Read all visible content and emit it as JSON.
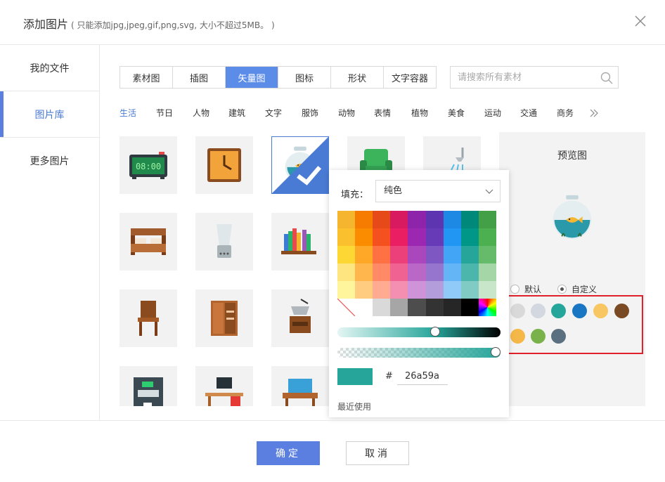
{
  "dialog": {
    "title": "添加图片",
    "subtitle": "( 只能添加jpg,jpeg,gif,png,svg, 大小不超过5MB。 )",
    "close_icon": "close-icon"
  },
  "sidebar": {
    "items": [
      {
        "label": "我的文件",
        "active": false
      },
      {
        "label": "图片库",
        "active": true
      },
      {
        "label": "更多图片",
        "active": false
      }
    ]
  },
  "tabs": [
    {
      "label": "素材图",
      "active": false
    },
    {
      "label": "插图",
      "active": false
    },
    {
      "label": "矢量图",
      "active": true
    },
    {
      "label": "图标",
      "active": false
    },
    {
      "label": "形状",
      "active": false
    },
    {
      "label": "文字容器",
      "active": false
    }
  ],
  "search": {
    "placeholder": "请搜索所有素材",
    "value": "",
    "icon": "search-icon"
  },
  "categories": [
    {
      "label": "生活",
      "active": true
    },
    {
      "label": "节日",
      "active": false
    },
    {
      "label": "人物",
      "active": false
    },
    {
      "label": "建筑",
      "active": false
    },
    {
      "label": "文字",
      "active": false
    },
    {
      "label": "服饰",
      "active": false
    },
    {
      "label": "动物",
      "active": false
    },
    {
      "label": "表情",
      "active": false
    },
    {
      "label": "植物",
      "active": false
    },
    {
      "label": "美食",
      "active": false
    },
    {
      "label": "运动",
      "active": false
    },
    {
      "label": "交通",
      "active": false
    },
    {
      "label": "商务",
      "active": false
    }
  ],
  "more_categories_icon": "double-chevron-right-icon",
  "thumbnails": [
    {
      "icon": "digital-clock-icon",
      "time_text": "08:00",
      "selected": false
    },
    {
      "icon": "wall-clock-icon",
      "selected": false
    },
    {
      "icon": "fishbowl-icon",
      "selected": true
    },
    {
      "icon": "armchair-icon",
      "selected": false
    },
    {
      "icon": "shower-icon",
      "selected": false
    },
    {
      "icon": "bed-icon",
      "selected": false
    },
    {
      "icon": "blender-icon",
      "selected": false
    },
    {
      "icon": "bookshelf-icon",
      "selected": false
    },
    {
      "icon": "chair-icon",
      "selected": false
    },
    {
      "icon": "wardrobe-icon",
      "selected": false
    },
    {
      "icon": "coffee-grinder-icon",
      "selected": false
    },
    {
      "icon": "coffee-machine-icon",
      "selected": false
    },
    {
      "icon": "computer-desk-icon",
      "selected": false
    },
    {
      "icon": "dresser-icon",
      "selected": false
    }
  ],
  "fill_popup": {
    "label": "填充：",
    "mode": "纯色",
    "hex_prefix": "#",
    "hex_value": "26a59a",
    "current_color": "#26a59a",
    "hue_value": 0.6,
    "alpha_value": 1.0,
    "recent_label": "最近使用",
    "palette": [
      [
        "#f6b52e",
        "#f57c00",
        "#e64a19",
        "#d81b60",
        "#8e24aa",
        "#5e35b1",
        "#1e88e5",
        "#00897b",
        "#43a047"
      ],
      [
        "#fbc02d",
        "#fb8c00",
        "#f4511e",
        "#e91e63",
        "#9c27b0",
        "#673ab7",
        "#2196f3",
        "#009688",
        "#4caf50"
      ],
      [
        "#fdd835",
        "#ffa726",
        "#ff7043",
        "#ec407a",
        "#ab47bc",
        "#7e57c2",
        "#42a5f5",
        "#26a69a",
        "#66bb6a"
      ],
      [
        "#ffe57f",
        "#ffb74d",
        "#ff8a65",
        "#f06292",
        "#ba68c8",
        "#9575cd",
        "#64b5f6",
        "#4db6ac",
        "#a5d6a7"
      ],
      [
        "#fff59d",
        "#ffcc80",
        "#ffab91",
        "#f48fb1",
        "#ce93d8",
        "#b39ddb",
        "#90caf9",
        "#80cbc4",
        "#c8e6c9"
      ],
      [
        "none",
        "#ffffff",
        "#d9d9d9",
        "#a6a6a6",
        "#4d4d4d",
        "#333333",
        "#262626",
        "#000000",
        "spectrum"
      ]
    ]
  },
  "preview": {
    "title": "预览图",
    "image_icon": "fishbowl-icon",
    "options": [
      {
        "label": "默认",
        "checked": false
      },
      {
        "label": "自定义",
        "checked": true
      }
    ],
    "swatches": [
      "#d9d9d9",
      "#d3d8e0",
      "#26a59a",
      "#1976c2",
      "#f8c662",
      "#7a4a24",
      "#f5b848",
      "#79b24a",
      "#5a7080"
    ]
  },
  "footer": {
    "ok_label": "确定",
    "cancel_label": "取消"
  }
}
